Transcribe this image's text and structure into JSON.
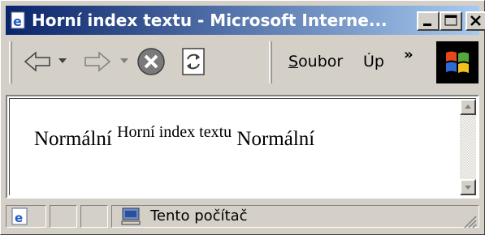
{
  "window": {
    "title": "Horní index textu - Microsoft Interne..."
  },
  "toolbar": {
    "back_icon": "back-arrow-icon",
    "forward_icon": "forward-arrow-icon",
    "stop_icon": "stop-icon",
    "refresh_icon": "refresh-icon",
    "menu_soubor_prefix": "S",
    "menu_soubor_rest": "oubor",
    "menu_up": "Úp",
    "chevron": "»"
  },
  "content": {
    "text_before": "Normální ",
    "superscript": "Horní index textu",
    "text_after": " Normální"
  },
  "statusbar": {
    "zone": "Tento počítač"
  },
  "colors": {
    "titlebar_start": "#0a246a",
    "titlebar_end": "#a6caf0",
    "chrome": "#d4d0c8"
  }
}
